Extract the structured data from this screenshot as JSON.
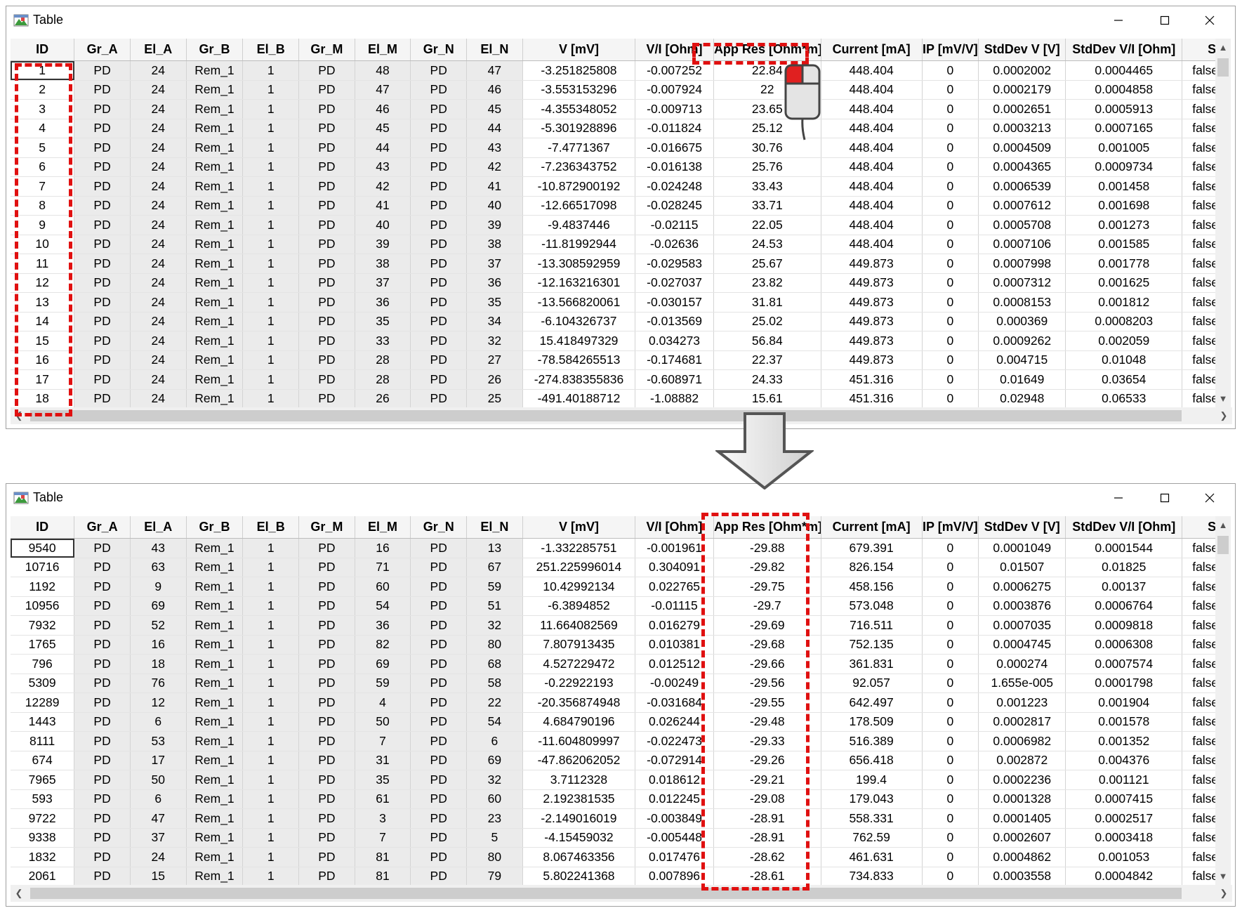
{
  "window_title": "Table",
  "columns": [
    "ID",
    "Gr_A",
    "El_A",
    "Gr_B",
    "El_B",
    "Gr_M",
    "El_M",
    "Gr_N",
    "El_N",
    "V [mV]",
    "V/I [Ohm]",
    "App Res [Ohm*m]",
    "Current [mA]",
    "IP [mV/V]",
    "StdDev V [V]",
    "StdDev V/I [Ohm]",
    "Skip"
  ],
  "top_rows": [
    [
      "1",
      "PD",
      "24",
      "Rem_1",
      "1",
      "PD",
      "48",
      "PD",
      "47",
      "-3.251825808",
      "-0.007252",
      "22.84",
      "448.404",
      "0",
      "0.0002002",
      "0.0004465",
      "false"
    ],
    [
      "2",
      "PD",
      "24",
      "Rem_1",
      "1",
      "PD",
      "47",
      "PD",
      "46",
      "-3.553153296",
      "-0.007924",
      "22",
      "448.404",
      "0",
      "0.0002179",
      "0.0004858",
      "false"
    ],
    [
      "3",
      "PD",
      "24",
      "Rem_1",
      "1",
      "PD",
      "46",
      "PD",
      "45",
      "-4.355348052",
      "-0.009713",
      "23.65",
      "448.404",
      "0",
      "0.0002651",
      "0.0005913",
      "false"
    ],
    [
      "4",
      "PD",
      "24",
      "Rem_1",
      "1",
      "PD",
      "45",
      "PD",
      "44",
      "-5.301928896",
      "-0.011824",
      "25.12",
      "448.404",
      "0",
      "0.0003213",
      "0.0007165",
      "false"
    ],
    [
      "5",
      "PD",
      "24",
      "Rem_1",
      "1",
      "PD",
      "44",
      "PD",
      "43",
      "-7.4771367",
      "-0.016675",
      "30.76",
      "448.404",
      "0",
      "0.0004509",
      "0.001005",
      "false"
    ],
    [
      "6",
      "PD",
      "24",
      "Rem_1",
      "1",
      "PD",
      "43",
      "PD",
      "42",
      "-7.236343752",
      "-0.016138",
      "25.76",
      "448.404",
      "0",
      "0.0004365",
      "0.0009734",
      "false"
    ],
    [
      "7",
      "PD",
      "24",
      "Rem_1",
      "1",
      "PD",
      "42",
      "PD",
      "41",
      "-10.872900192",
      "-0.024248",
      "33.43",
      "448.404",
      "0",
      "0.0006539",
      "0.001458",
      "false"
    ],
    [
      "8",
      "PD",
      "24",
      "Rem_1",
      "1",
      "PD",
      "41",
      "PD",
      "40",
      "-12.66517098",
      "-0.028245",
      "33.71",
      "448.404",
      "0",
      "0.0007612",
      "0.001698",
      "false"
    ],
    [
      "9",
      "PD",
      "24",
      "Rem_1",
      "1",
      "PD",
      "40",
      "PD",
      "39",
      "-9.4837446",
      "-0.02115",
      "22.05",
      "448.404",
      "0",
      "0.0005708",
      "0.001273",
      "false"
    ],
    [
      "10",
      "PD",
      "24",
      "Rem_1",
      "1",
      "PD",
      "39",
      "PD",
      "38",
      "-11.81992944",
      "-0.02636",
      "24.53",
      "448.404",
      "0",
      "0.0007106",
      "0.001585",
      "false"
    ],
    [
      "11",
      "PD",
      "24",
      "Rem_1",
      "1",
      "PD",
      "38",
      "PD",
      "37",
      "-13.308592959",
      "-0.029583",
      "25.67",
      "449.873",
      "0",
      "0.0007998",
      "0.001778",
      "false"
    ],
    [
      "12",
      "PD",
      "24",
      "Rem_1",
      "1",
      "PD",
      "37",
      "PD",
      "36",
      "-12.163216301",
      "-0.027037",
      "23.82",
      "449.873",
      "0",
      "0.0007312",
      "0.001625",
      "false"
    ],
    [
      "13",
      "PD",
      "24",
      "Rem_1",
      "1",
      "PD",
      "36",
      "PD",
      "35",
      "-13.566820061",
      "-0.030157",
      "31.81",
      "449.873",
      "0",
      "0.0008153",
      "0.001812",
      "false"
    ],
    [
      "14",
      "PD",
      "24",
      "Rem_1",
      "1",
      "PD",
      "35",
      "PD",
      "34",
      "-6.104326737",
      "-0.013569",
      "25.02",
      "449.873",
      "0",
      "0.000369",
      "0.0008203",
      "false"
    ],
    [
      "15",
      "PD",
      "24",
      "Rem_1",
      "1",
      "PD",
      "33",
      "PD",
      "32",
      "15.418497329",
      "0.034273",
      "56.84",
      "449.873",
      "0",
      "0.0009262",
      "0.002059",
      "false"
    ],
    [
      "16",
      "PD",
      "24",
      "Rem_1",
      "1",
      "PD",
      "28",
      "PD",
      "27",
      "-78.584265513",
      "-0.174681",
      "22.37",
      "449.873",
      "0",
      "0.004715",
      "0.01048",
      "false"
    ],
    [
      "17",
      "PD",
      "24",
      "Rem_1",
      "1",
      "PD",
      "28",
      "PD",
      "26",
      "-274.838355836",
      "-0.608971",
      "24.33",
      "451.316",
      "0",
      "0.01649",
      "0.03654",
      "false"
    ],
    [
      "18",
      "PD",
      "24",
      "Rem_1",
      "1",
      "PD",
      "26",
      "PD",
      "25",
      "-491.40188712",
      "-1.08882",
      "15.61",
      "451.316",
      "0",
      "0.02948",
      "0.06533",
      "false"
    ]
  ],
  "bottom_rows": [
    [
      "9540",
      "PD",
      "43",
      "Rem_1",
      "1",
      "PD",
      "16",
      "PD",
      "13",
      "-1.332285751",
      "-0.001961",
      "-29.88",
      "679.391",
      "0",
      "0.0001049",
      "0.0001544",
      "false"
    ],
    [
      "10716",
      "PD",
      "63",
      "Rem_1",
      "1",
      "PD",
      "71",
      "PD",
      "67",
      "251.225996014",
      "0.304091",
      "-29.82",
      "826.154",
      "0",
      "0.01507",
      "0.01825",
      "false"
    ],
    [
      "1192",
      "PD",
      "9",
      "Rem_1",
      "1",
      "PD",
      "60",
      "PD",
      "59",
      "10.42992134",
      "0.022765",
      "-29.75",
      "458.156",
      "0",
      "0.0006275",
      "0.00137",
      "false"
    ],
    [
      "10956",
      "PD",
      "69",
      "Rem_1",
      "1",
      "PD",
      "54",
      "PD",
      "51",
      "-6.3894852",
      "-0.01115",
      "-29.7",
      "573.048",
      "0",
      "0.0003876",
      "0.0006764",
      "false"
    ],
    [
      "7932",
      "PD",
      "52",
      "Rem_1",
      "1",
      "PD",
      "36",
      "PD",
      "32",
      "11.664082569",
      "0.016279",
      "-29.69",
      "716.511",
      "0",
      "0.0007035",
      "0.0009818",
      "false"
    ],
    [
      "1765",
      "PD",
      "16",
      "Rem_1",
      "1",
      "PD",
      "82",
      "PD",
      "80",
      "7.807913435",
      "0.010381",
      "-29.68",
      "752.135",
      "0",
      "0.0004745",
      "0.0006308",
      "false"
    ],
    [
      "796",
      "PD",
      "18",
      "Rem_1",
      "1",
      "PD",
      "69",
      "PD",
      "68",
      "4.527229472",
      "0.012512",
      "-29.66",
      "361.831",
      "0",
      "0.000274",
      "0.0007574",
      "false"
    ],
    [
      "5309",
      "PD",
      "76",
      "Rem_1",
      "1",
      "PD",
      "59",
      "PD",
      "58",
      "-0.22922193",
      "-0.00249",
      "-29.56",
      "92.057",
      "0",
      "1.655e-005",
      "0.0001798",
      "false"
    ],
    [
      "12289",
      "PD",
      "12",
      "Rem_1",
      "1",
      "PD",
      "4",
      "PD",
      "22",
      "-20.356874948",
      "-0.031684",
      "-29.55",
      "642.497",
      "0",
      "0.001223",
      "0.001904",
      "false"
    ],
    [
      "1443",
      "PD",
      "6",
      "Rem_1",
      "1",
      "PD",
      "50",
      "PD",
      "54",
      "4.684790196",
      "0.026244",
      "-29.48",
      "178.509",
      "0",
      "0.0002817",
      "0.001578",
      "false"
    ],
    [
      "8111",
      "PD",
      "53",
      "Rem_1",
      "1",
      "PD",
      "7",
      "PD",
      "6",
      "-11.604809997",
      "-0.022473",
      "-29.33",
      "516.389",
      "0",
      "0.0006982",
      "0.001352",
      "false"
    ],
    [
      "674",
      "PD",
      "17",
      "Rem_1",
      "1",
      "PD",
      "31",
      "PD",
      "69",
      "-47.862062052",
      "-0.072914",
      "-29.26",
      "656.418",
      "0",
      "0.002872",
      "0.004376",
      "false"
    ],
    [
      "7965",
      "PD",
      "50",
      "Rem_1",
      "1",
      "PD",
      "35",
      "PD",
      "32",
      "3.7112328",
      "0.018612",
      "-29.21",
      "199.4",
      "0",
      "0.0002236",
      "0.001121",
      "false"
    ],
    [
      "593",
      "PD",
      "6",
      "Rem_1",
      "1",
      "PD",
      "61",
      "PD",
      "60",
      "2.192381535",
      "0.012245",
      "-29.08",
      "179.043",
      "0",
      "0.0001328",
      "0.0007415",
      "false"
    ],
    [
      "9722",
      "PD",
      "47",
      "Rem_1",
      "1",
      "PD",
      "3",
      "PD",
      "23",
      "-2.149016019",
      "-0.003849",
      "-28.91",
      "558.331",
      "0",
      "0.0001405",
      "0.0002517",
      "false"
    ],
    [
      "9338",
      "PD",
      "37",
      "Rem_1",
      "1",
      "PD",
      "7",
      "PD",
      "5",
      "-4.15459032",
      "-0.005448",
      "-28.91",
      "762.59",
      "0",
      "0.0002607",
      "0.0003418",
      "false"
    ],
    [
      "1832",
      "PD",
      "24",
      "Rem_1",
      "1",
      "PD",
      "81",
      "PD",
      "80",
      "8.067463356",
      "0.017476",
      "-28.62",
      "461.631",
      "0",
      "0.0004862",
      "0.001053",
      "false"
    ],
    [
      "2061",
      "PD",
      "15",
      "Rem_1",
      "1",
      "PD",
      "81",
      "PD",
      "79",
      "5.802241368",
      "0.007896",
      "-28.61",
      "734.833",
      "0",
      "0.0003558",
      "0.0004842",
      "false"
    ]
  ],
  "icons": {
    "app": "table-app-icon",
    "minimize": "minimize-icon",
    "maximize": "maximize-icon",
    "close": "close-icon",
    "mouse": "mouse-click-icon",
    "down_arrow": "down-arrow-icon"
  },
  "colors": {
    "highlight": "#e01010",
    "frozen_column_bg": "#ebebeb",
    "window_border": "#a0a0a0"
  }
}
